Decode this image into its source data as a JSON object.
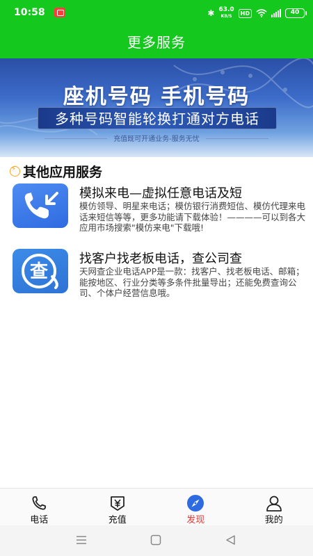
{
  "status_bar": {
    "time": "10:58",
    "net_speed_value": "63.0",
    "net_speed_unit": "KB/S",
    "hd": "HD",
    "battery": "40"
  },
  "header": {
    "title": "更多服务"
  },
  "banner": {
    "title": "座机号码 手机号码",
    "subtitle": "多种号码智能轮换打通对方电话",
    "note": "充值既可开通业务-服务无忧"
  },
  "section": {
    "title": "其他应用服务"
  },
  "apps": [
    {
      "title": "模拟来电—虚拟任意电话及短",
      "description": "模仿领导、明星来电话；模仿银行消费短信、模仿代理来电话来短信等等，更多功能请下载体验！————可以到各大应用市场搜索\"模仿来电\"下载哦!",
      "icon": "incoming-call-icon",
      "icon_text": ""
    },
    {
      "title": "找客户找老板电话，查公司查",
      "description": "天网查企业电话APP是一款：找客户、找老板电话、邮箱；能按地区、行业分类等多条件批量导出；还能免费查询公司、个体户经营信息哦。",
      "icon": "search-company-icon",
      "icon_text": "查"
    }
  ],
  "bottom_nav": [
    {
      "label": "电话",
      "icon": "phone-icon",
      "active": false
    },
    {
      "label": "充值",
      "icon": "yuan-icon",
      "active": false
    },
    {
      "label": "发现",
      "icon": "compass-icon",
      "active": true
    },
    {
      "label": "我的",
      "icon": "user-icon",
      "active": false
    }
  ],
  "colors": {
    "header_green": "#14c81e",
    "active_red": "#e53935",
    "compass_blue": "#2f6be0"
  }
}
